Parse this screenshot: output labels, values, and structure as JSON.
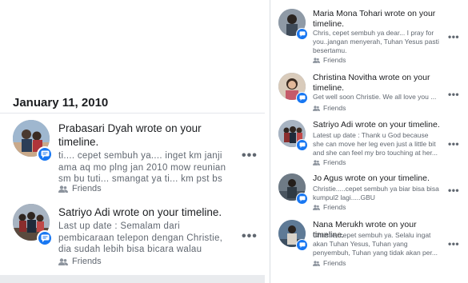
{
  "left": {
    "date_header": "January 11, 2010",
    "posts": [
      {
        "title": "Prabasari Dyah wrote on your timeline.",
        "body": "ti.... cepet sembuh ya.... inget km janji ama aq mo plng jan 2010 mow reunian sm bu tuti... smangat ya ti... km pst bs ...",
        "privacy": "Friends",
        "more": "•••"
      },
      {
        "title": "Satriyo Adi wrote on your timeline.",
        "body": "Last up date : Semalam dari pembicaraan telepon dengan Christie, dia sudah lebih bisa bicara walau susah...",
        "privacy": "Friends",
        "more": "•••"
      }
    ]
  },
  "right": {
    "posts": [
      {
        "title": "Maria Mona Tohari wrote on your timeline.",
        "body": "Chris, cepet sembuh ya dear... I pray for you..jangan menyerah, Tuhan Yesus pasti besertamu.",
        "privacy": "Friends",
        "more": "•••"
      },
      {
        "title": "Christina Novitha wrote on your timeline.",
        "body": "Get well soon Christie. We all love you ...",
        "privacy": "Friends",
        "more": "•••"
      },
      {
        "title": "Satriyo Adi wrote on your timeline.",
        "body": "Latest up date : Thank u God because she can move her leg even just a little bit and she can feel my bro touching at her...",
        "privacy": "Friends",
        "more": "•••"
      },
      {
        "title": "Jo Agus wrote on your timeline.",
        "body": "Christie.....cepet sembuh ya biar bisa bisa kumpul2 lagi.....GBU",
        "privacy": "Friends",
        "more": "•••"
      },
      {
        "title": "Nana Merukh wrote on your timeline.",
        "body": "Christie, cepet sembuh ya. Selalu ingat akan Tuhan Yesus, Tuhan yang penyembuh, Tuhan yang tidak akan per...",
        "privacy": "Friends",
        "more": "•••"
      }
    ]
  },
  "icons": {
    "badge": "comment-bubble-icon",
    "privacy": "friends-icon",
    "more": "more-options-icon"
  },
  "colors": {
    "accent": "#1877f2",
    "secondary_text": "#606770",
    "primary_text": "#1c1e21"
  }
}
